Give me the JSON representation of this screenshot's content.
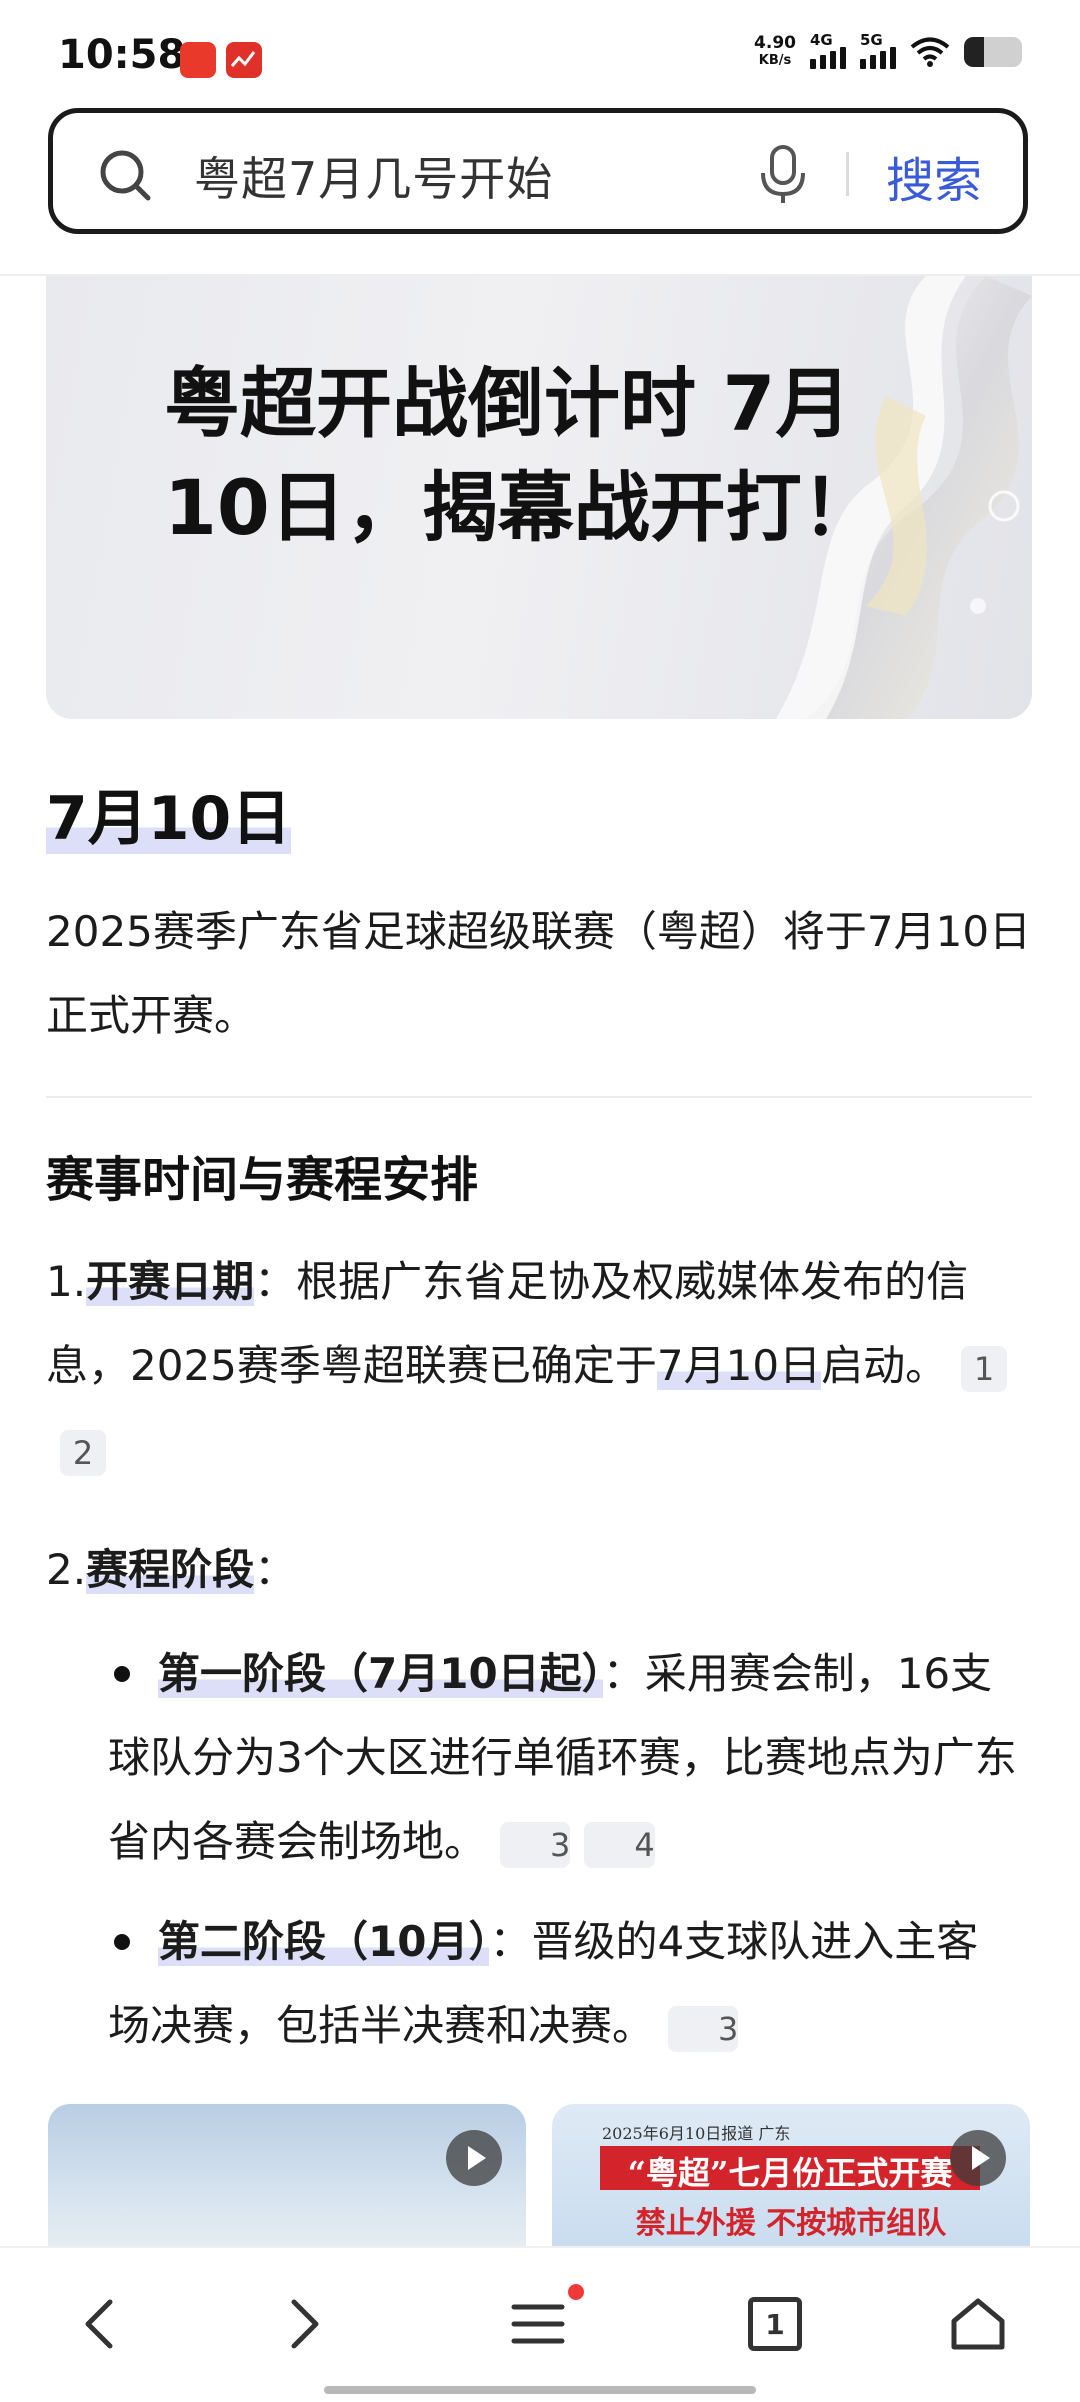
{
  "status_bar": {
    "time": "10:58",
    "net_speed_value": "4.90",
    "net_speed_unit": "KB/s",
    "signal1_label": "4G",
    "signal2_label": "5G",
    "battery_level_fraction": 0.35
  },
  "search": {
    "query": "粤超7月几号开始",
    "button": "搜索"
  },
  "hero": {
    "title": "粤超开战倒计时 7月10日，揭幕战开打！"
  },
  "answer": {
    "date": "7月10日",
    "summary": "2025赛季广东省足球超级联赛（粤超）将于7月10日正式开赛。"
  },
  "section": {
    "heading": "赛事时间与赛程安排",
    "item1": {
      "num": "1.",
      "label": "开赛日期",
      "sep": "：",
      "text_a": "根据广东省足协及权威媒体发布的信息，2025赛季粤超联赛已确定于",
      "text_highlight": "7月10日",
      "text_b": "启动。",
      "cites": [
        "1",
        "2"
      ]
    },
    "item2": {
      "num": "2.",
      "label": "赛程阶段",
      "sep": "：",
      "bullets": [
        {
          "label": "第一阶段（7月10日起）",
          "sep": "：",
          "text": "采用赛会制，16支球队分为3个大区进行单循环赛，比赛地点为广东省内各赛会制场地。",
          "cites": [
            "3",
            "4"
          ]
        },
        {
          "label": "第二阶段（10月）",
          "sep": "：",
          "text": "晋级的4支球队进入主客场决赛，包括半决赛和决赛。",
          "cites": [
            "3"
          ]
        }
      ]
    }
  },
  "videos": [
    {
      "thumb_lines": []
    },
    {
      "thumb_lines": [
        "2025年6月10日报道 广东",
        "“粤超”七月份正式开赛",
        "禁止外援 不按城市组队"
      ]
    }
  ],
  "nav": {
    "tab_count": "1"
  }
}
